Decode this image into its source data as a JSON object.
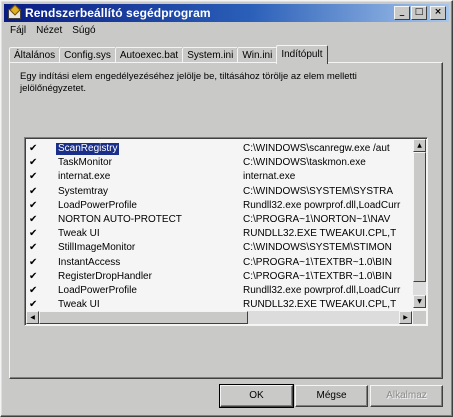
{
  "window": {
    "title": "Rendszerbeállító segédprogram",
    "title_buttons": [
      "_",
      "□",
      "×"
    ]
  },
  "menu": [
    "Fájl",
    "Nézet",
    "Súgó"
  ],
  "tabs": [
    "Általános",
    "Config.sys",
    "Autoexec.bat",
    "System.ini",
    "Win.ini",
    "Indítópult"
  ],
  "active_tab": "Indítópult",
  "instructions": "Egy indítási elem engedélyezéséhez jelölje be, tiltásához törölje az elem melletti jelölőnégyzetet.",
  "startup_items": [
    {
      "checked": true,
      "name": "ScanRegistry",
      "path": "C:\\WINDOWS\\scanregw.exe /aut",
      "selected": true
    },
    {
      "checked": true,
      "name": "TaskMonitor",
      "path": "C:\\WINDOWS\\taskmon.exe",
      "selected": false
    },
    {
      "checked": true,
      "name": "internat.exe",
      "path": "internat.exe",
      "selected": false
    },
    {
      "checked": true,
      "name": "Systemtray",
      "path": "C:\\WINDOWS\\SYSTEM\\SYSTRA",
      "selected": false
    },
    {
      "checked": true,
      "name": "LoadPowerProfile",
      "path": "Rundll32.exe powrprof.dll,LoadCurr",
      "selected": false
    },
    {
      "checked": true,
      "name": "NORTON AUTO-PROTECT",
      "path": "C:\\PROGRA~1\\NORTON~1\\NAV",
      "selected": false
    },
    {
      "checked": true,
      "name": "Tweak UI",
      "path": "RUNDLL32.EXE TWEAKUI.CPL,T",
      "selected": false
    },
    {
      "checked": true,
      "name": "StillImageMonitor",
      "path": "C:\\WINDOWS\\SYSTEM\\STIMON",
      "selected": false
    },
    {
      "checked": true,
      "name": "InstantAccess",
      "path": "C:\\PROGRA~1\\TEXTBR~1.0\\BIN",
      "selected": false
    },
    {
      "checked": true,
      "name": "RegisterDropHandler",
      "path": "C:\\PROGRA~1\\TEXTBR~1.0\\BIN",
      "selected": false
    },
    {
      "checked": true,
      "name": "LoadPowerProfile",
      "path": "Rundll32.exe powrprof.dll,LoadCurr",
      "selected": false
    },
    {
      "checked": true,
      "name": "Tweak UI",
      "path": "RUNDLL32.EXE TWEAKUI.CPL,T",
      "selected": false
    }
  ],
  "check_glyph": "✔",
  "scroll_glyphs": {
    "up": "▲",
    "down": "▼",
    "left": "◀",
    "right": "▶"
  },
  "buttons": {
    "ok": "OK",
    "cancel": "Mégse",
    "apply": "Alkalmaz"
  },
  "colors": {
    "title_start": "#0a1c83",
    "title_end": "#a6c6ec",
    "selection": "#1a2f8a",
    "face": "#c9cac8"
  }
}
